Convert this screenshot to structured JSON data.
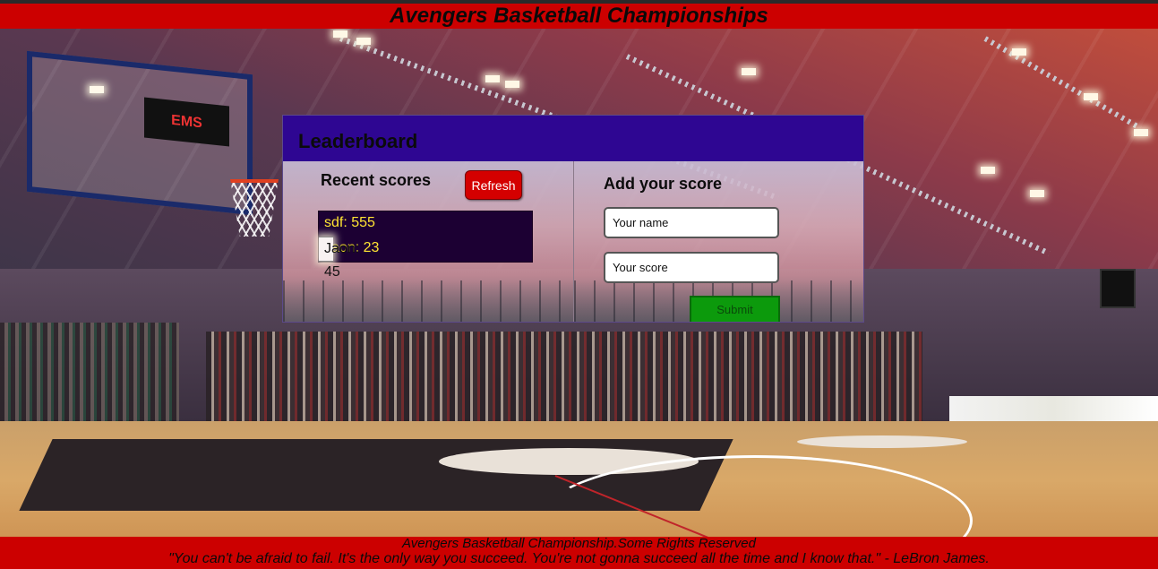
{
  "header": {
    "title": "Avengers Basketball Championships"
  },
  "leaderboard": {
    "title": "Leaderboard",
    "recent": {
      "heading": "Recent scores",
      "refresh_label": "Refresh",
      "scores": [
        "sdf: 555",
        "Jaon: 45",
        "Jaon: 23"
      ]
    },
    "add": {
      "heading": "Add your score",
      "name_placeholder": "Your name",
      "score_placeholder": "Your score",
      "submit_label": "Submit"
    }
  },
  "footer": {
    "rights": "Avengers Basketball Championship.Some Rights Reserved",
    "quote": "\"You can't be afraid to fail. It's the only way you succeed. You're not gonna succeed all the time and I know that.\" - LeBron James."
  },
  "background": {
    "backboard_logo": "EMS"
  },
  "colors": {
    "header_bg": "#cc0000",
    "panel_header_bg": "#2e0692",
    "refresh_bg": "#d40000",
    "submit_bg": "#0c9a0c",
    "score_row_dark": "#1c0033",
    "score_text_yellow": "#ffe433"
  }
}
